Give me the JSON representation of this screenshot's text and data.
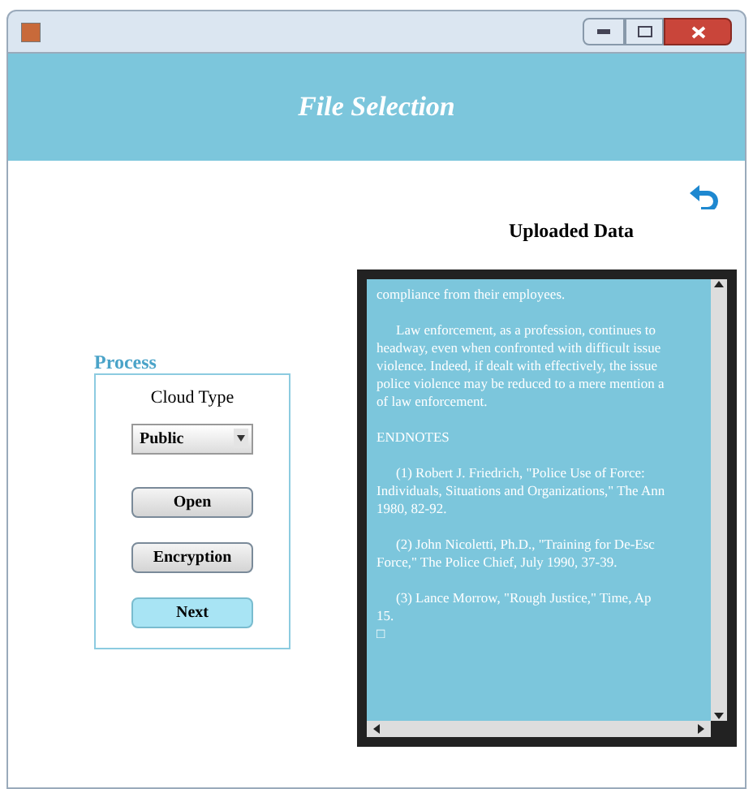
{
  "window": {
    "title": "File Selection"
  },
  "uploaded_data": {
    "heading": "Uploaded Data",
    "paragraphs": [
      {
        "lines": [
          {
            "text": "compliance from their employees.",
            "indent": false
          }
        ]
      },
      {
        "lines": [
          {
            "text": "Law enforcement, as a profession, continues to",
            "indent": true
          },
          {
            "text": "headway, even when confronted with difficult issue",
            "indent": false
          },
          {
            "text": "violence.  Indeed, if dealt with effectively, the issue",
            "indent": false
          },
          {
            "text": "police violence may be reduced to a mere mention a",
            "indent": false
          },
          {
            "text": "of law enforcement.",
            "indent": false
          }
        ]
      },
      {
        "lines": [
          {
            "text": "ENDNOTES",
            "indent": false
          }
        ]
      },
      {
        "lines": [
          {
            "text": "(1)  Robert J. Friedrich, \"Police Use of Force:",
            "indent": true
          },
          {
            "text": "Individuals, Situations and Organizations,\" The Ann",
            "indent": false
          },
          {
            "text": "1980, 82-92.",
            "indent": false
          }
        ]
      },
      {
        "lines": [
          {
            "text": "(2)  John Nicoletti, Ph.D., \"Training for De-Esc",
            "indent": true
          },
          {
            "text": "Force,\" The Police Chief, July 1990, 37-39.",
            "indent": false
          }
        ]
      },
      {
        "lines": [
          {
            "text": "(3)  Lance Morrow, \"Rough Justice,\" Time,  Ap",
            "indent": true
          },
          {
            "text": "15.",
            "indent": false
          },
          {
            "text": "□",
            "indent": false
          }
        ]
      }
    ]
  },
  "process": {
    "title": "Process",
    "cloud_type_label": "Cloud Type",
    "cloud_type_value": "Public",
    "buttons": [
      {
        "label": "Open",
        "kind": "plain"
      },
      {
        "label": "Encryption",
        "kind": "plain"
      },
      {
        "label": "Next",
        "kind": "primary"
      }
    ]
  }
}
